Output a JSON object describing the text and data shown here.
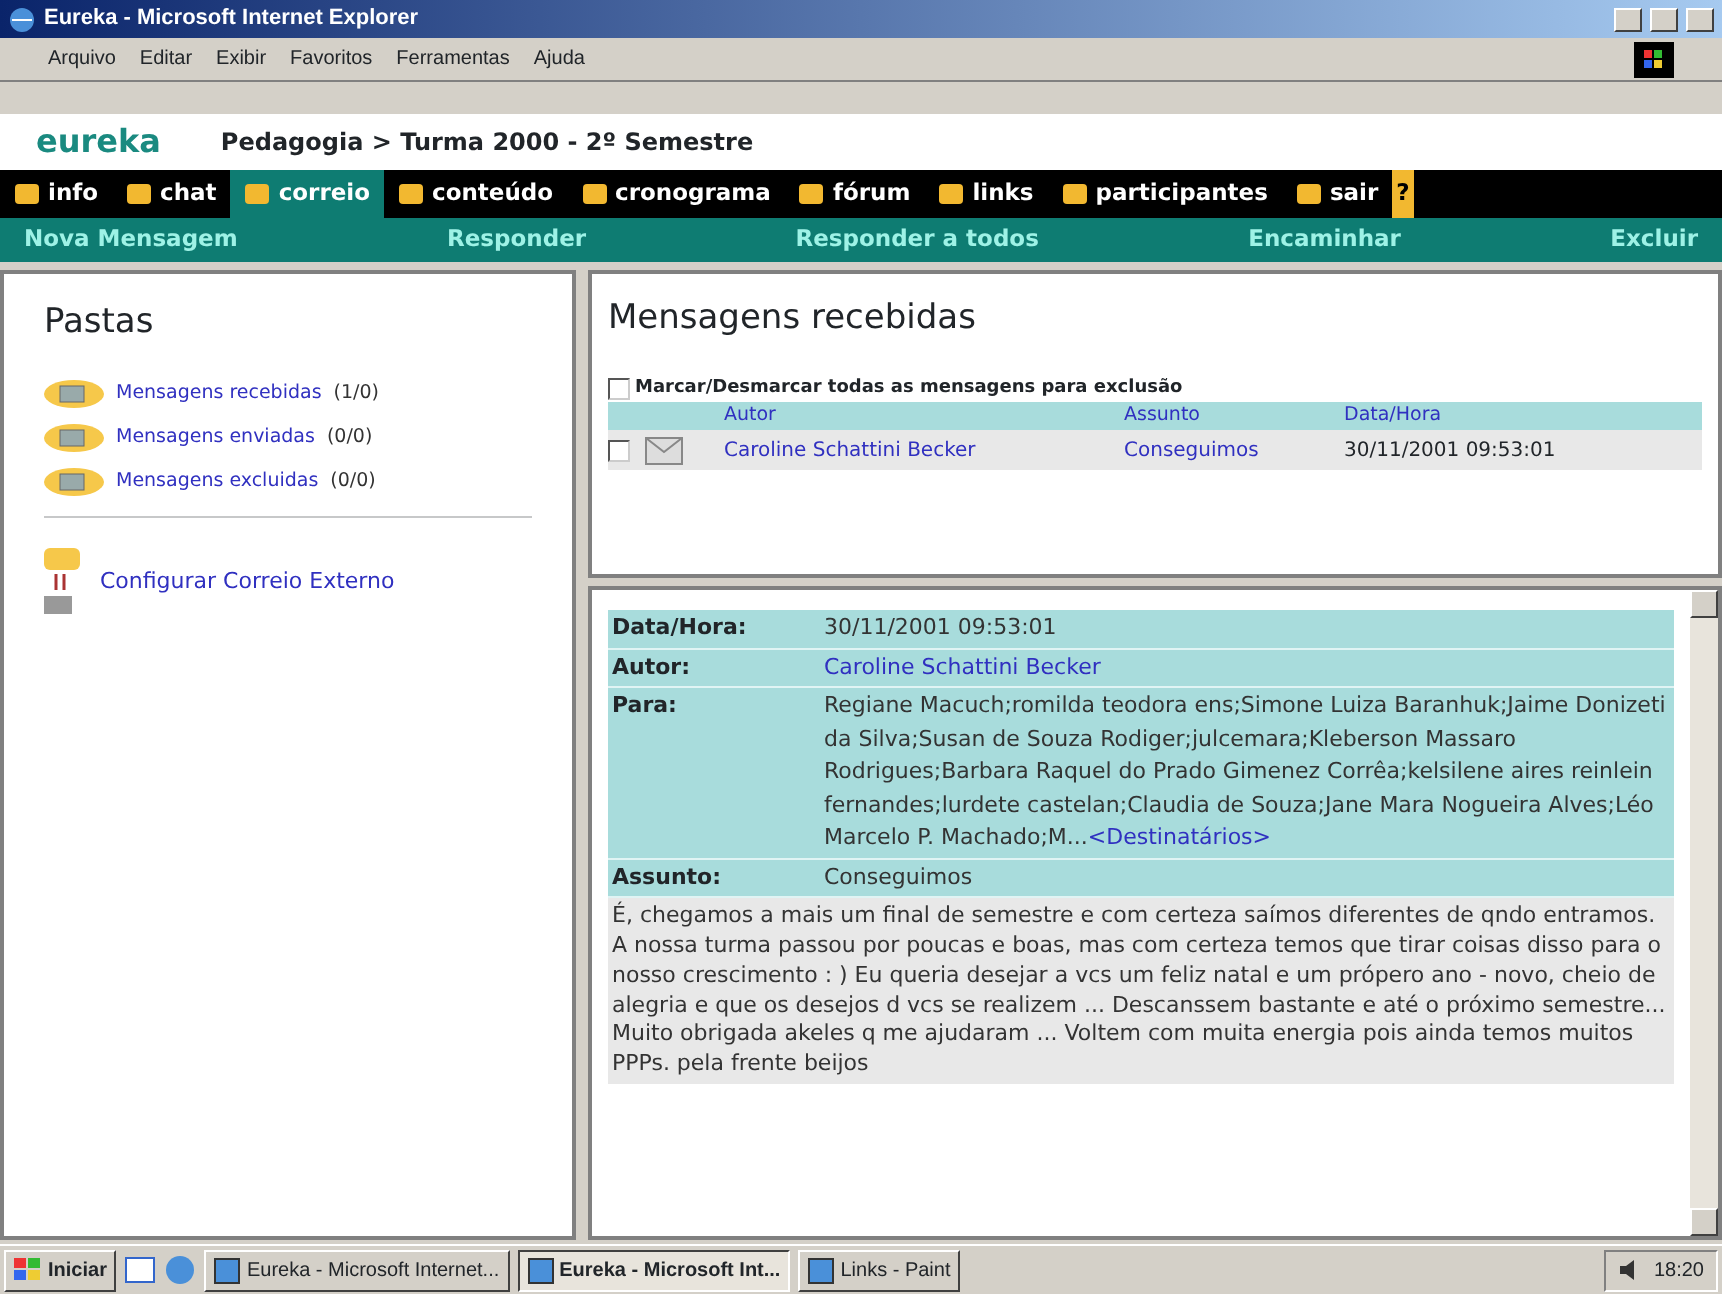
{
  "window": {
    "title": "Eureka - Microsoft Internet Explorer"
  },
  "menu": [
    "Arquivo",
    "Editar",
    "Exibir",
    "Favoritos",
    "Ferramentas",
    "Ajuda"
  ],
  "header": {
    "logo": "eureka",
    "breadcrumb": "Pedagogia > Turma 2000 - 2º Semestre"
  },
  "nav": [
    {
      "label": "info",
      "selected": false
    },
    {
      "label": "chat",
      "selected": false
    },
    {
      "label": "correio",
      "selected": true
    },
    {
      "label": "conteúdo",
      "selected": false
    },
    {
      "label": "cronograma",
      "selected": false
    },
    {
      "label": "fórum",
      "selected": false
    },
    {
      "label": "links",
      "selected": false
    },
    {
      "label": "participantes",
      "selected": false
    },
    {
      "label": "sair",
      "selected": false
    }
  ],
  "help": "?",
  "actions": [
    "Nova Mensagem",
    "Responder",
    "Responder a todos",
    "Encaminhar",
    "Excluir"
  ],
  "sidebar": {
    "title": "Pastas",
    "folders": [
      {
        "name": "Mensagens recebidas",
        "count": "(1/0)"
      },
      {
        "name": "Mensagens enviadas",
        "count": "(0/0)"
      },
      {
        "name": "Mensagens excluidas",
        "count": "(0/0)"
      }
    ],
    "external": "Configurar Correio Externo"
  },
  "inbox": {
    "title": "Mensagens recebidas",
    "select_all": {
      "label": "Marcar/Desmarcar todas as mensagens para exclusão",
      "checked": false
    },
    "columns": [
      "Autor",
      "Assunto",
      "Data/Hora"
    ],
    "rows": [
      {
        "checked": false,
        "author": "Caroline Schattini Becker",
        "subject": "Conseguimos",
        "date": "30/11/2001 09:53:01"
      }
    ]
  },
  "message": {
    "fields": [
      {
        "label": "Data/Hora:",
        "value": "30/11/2001 09:53:01",
        "kind": "text"
      },
      {
        "label": "Autor:",
        "value": "Caroline Schattini Becker",
        "kind": "link"
      },
      {
        "label": "Para:",
        "value": "Regiane Macuch;romilda teodora ens;Simone Luiza Baranhuk;Jaime Donizeti da Silva;Susan de Souza Rodiger;julcemara;Kleberson Massaro Rodrigues;Barbara Raquel do Prado Gimenez Corrêa;kelsilene aires reinlein fernandes;lurdete castelan;Claudia de Souza;Jane Mara Nogueira Alves;Léo Marcelo P. Machado;M...",
        "link": "<Destinatários>",
        "kind": "recipients"
      },
      {
        "label": "Assunto:",
        "value": "Conseguimos",
        "kind": "text"
      }
    ],
    "body": "É, chegamos a mais um final de semestre e com certeza saímos diferentes de qndo entramos. A nossa turma passou por poucas e boas, mas com certeza temos que tirar coisas disso para o nosso crescimento : ) Eu queria desejar a vcs um feliz natal e um própero ano - novo, cheio de alegria e que os desejos d vcs se realizem ... Descanssem bastante e até o próximo semestre... Muito obrigada akeles q me ajudaram ... Voltem com muita energia pois ainda temos muitos PPPs. pela frente beijos"
  },
  "taskbar": {
    "start": "Iniciar",
    "tasks": [
      {
        "label": "Eureka - Microsoft Internet...",
        "selected": false
      },
      {
        "label": "Eureka - Microsoft Int...",
        "selected": true
      },
      {
        "label": "Links - Paint",
        "selected": false
      }
    ],
    "clock": "18:20"
  }
}
